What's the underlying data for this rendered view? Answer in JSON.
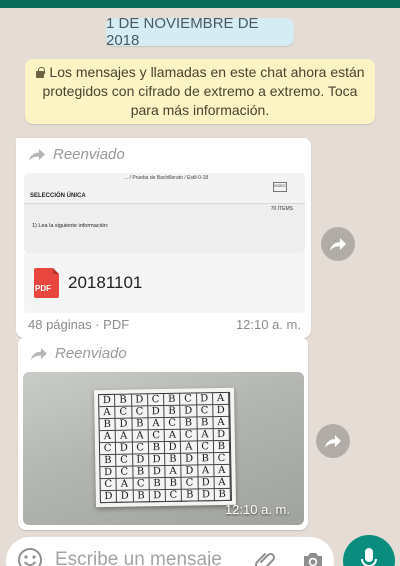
{
  "date_chip": "1 DE NOVIEMBRE DE 2018",
  "encryption_notice": "Los mensajes y llamadas en este chat ahora están protegidos con cifrado de extremo a extremo. Toca para más información.",
  "messages": [
    {
      "forwarded_label": "Reenviado",
      "doc_preview": {
        "header": "... / Prueba de Bachillerato / Estil-0-18",
        "logo": "DGEC",
        "heading": "SELECCIÓN ÚNICA",
        "items": "70 ÍTEMS",
        "question": "1)    Lea la siguiente información:"
      },
      "file_type_badge": "PDF",
      "file_name": "20181101",
      "meta": "48 páginas · PDF",
      "time": "12:10 a. m."
    },
    {
      "forwarded_label": "Reenviado",
      "image_icon": "answer-sheet-photo",
      "time": "12:10 a. m."
    }
  ],
  "composer": {
    "placeholder": "Escribe un mensaje"
  },
  "icons": {
    "forward": "forward-arrow-icon",
    "share": "share-icon",
    "emoji": "emoji-icon",
    "attach": "paperclip-icon",
    "camera": "camera-icon",
    "mic": "microphone-icon"
  },
  "colors": {
    "wallpaper": "#e5ddd5",
    "date_chip": "#d5ecf4",
    "notice": "#fcf4c4",
    "accent": "#0a8d7e",
    "pdf": "#e8463f"
  }
}
